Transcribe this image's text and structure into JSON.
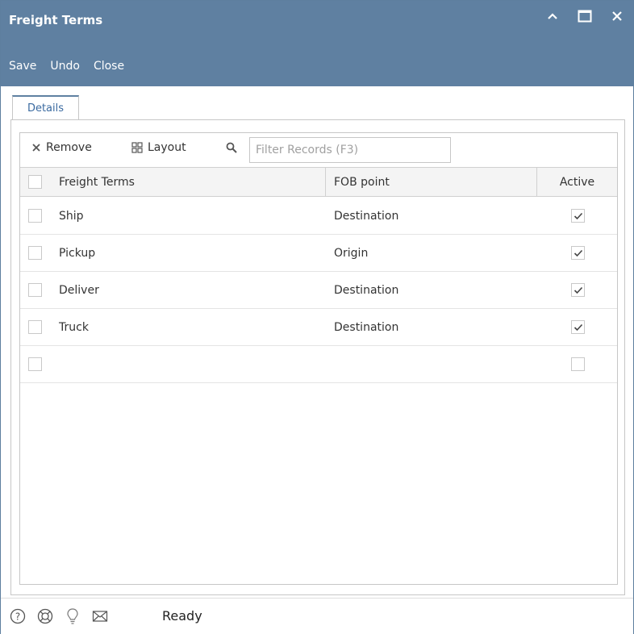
{
  "window": {
    "title": "Freight Terms"
  },
  "menu": {
    "save": "Save",
    "undo": "Undo",
    "close": "Close"
  },
  "tabs": [
    {
      "label": "Details",
      "active": true
    }
  ],
  "toolbar": {
    "remove_label": "Remove",
    "layout_label": "Layout",
    "filter_placeholder": "Filter Records (F3)"
  },
  "table": {
    "columns": [
      "Freight Terms",
      "FOB point",
      "Active"
    ],
    "rows": [
      {
        "freight_terms": "Ship",
        "fob_point": "Destination",
        "active": true
      },
      {
        "freight_terms": "Pickup",
        "fob_point": "Origin",
        "active": true
      },
      {
        "freight_terms": "Deliver",
        "fob_point": "Destination",
        "active": true
      },
      {
        "freight_terms": "Truck",
        "fob_point": "Destination",
        "active": true
      },
      {
        "freight_terms": "",
        "fob_point": "",
        "active": false
      }
    ]
  },
  "status": {
    "text": "Ready",
    "icons": [
      "help-icon",
      "lifebuoy-icon",
      "lightbulb-icon",
      "mail-icon"
    ]
  },
  "colors": {
    "header": "#5f80a1",
    "tab_accent": "#5f80a1",
    "tab_text": "#3a6aa0"
  }
}
